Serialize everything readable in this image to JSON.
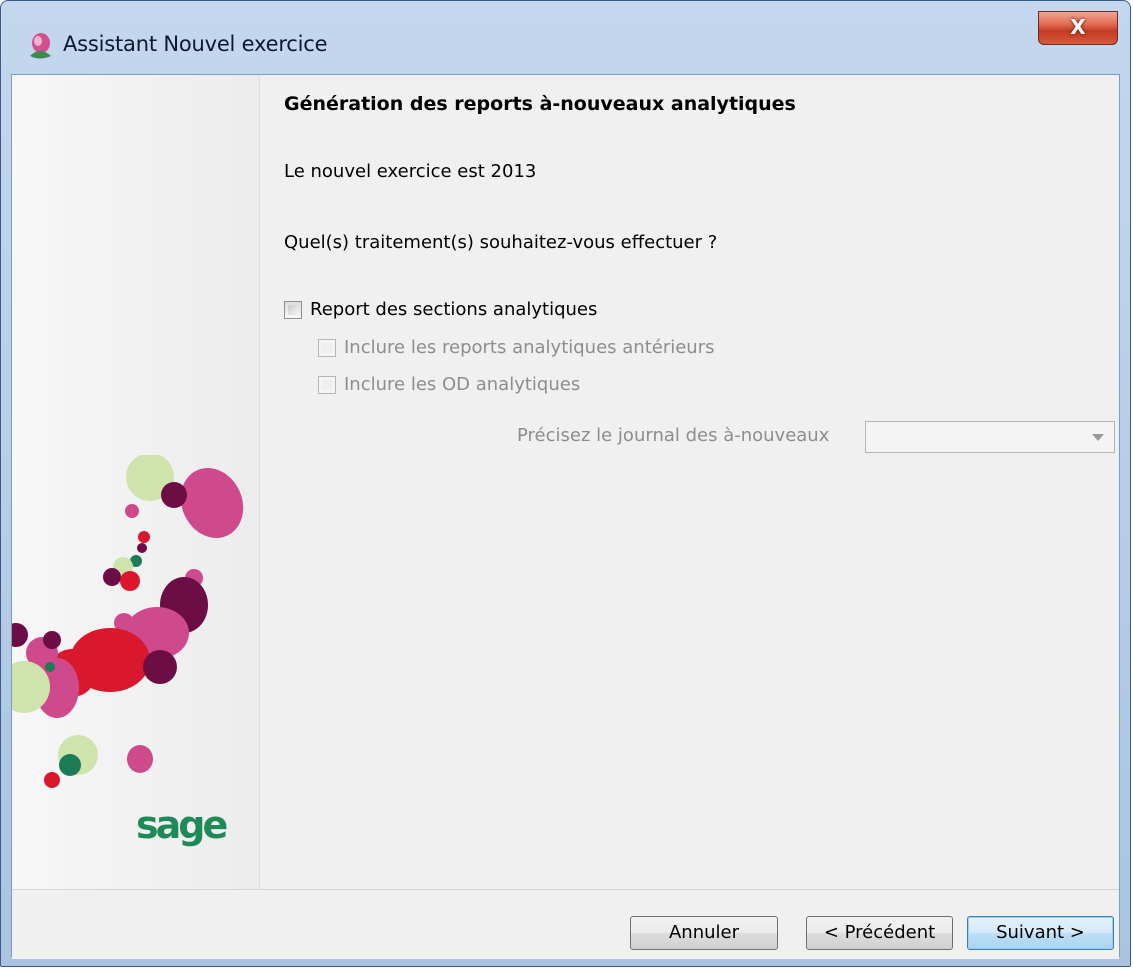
{
  "window": {
    "title": "Assistant Nouvel exercice",
    "close_label": "X"
  },
  "content": {
    "heading": "Génération des reports à-nouveaux analytiques",
    "new_year_text": "Le nouvel exercice est 2013",
    "question": "Quel(s) traitement(s) souhaitez-vous effectuer ?",
    "options": {
      "report_sections": {
        "label": "Report des sections analytiques",
        "checked": false,
        "enabled": true
      },
      "include_prior": {
        "label": "Inclure les reports analytiques antérieurs",
        "checked": false,
        "enabled": false
      },
      "include_od": {
        "label": "Inclure les OD analytiques",
        "checked": false,
        "enabled": false
      }
    },
    "journal": {
      "label": "Précisez le journal des à-nouveaux",
      "value": "",
      "enabled": false
    }
  },
  "branding": {
    "logo_text": "sage",
    "logo_color": "#1d8a57"
  },
  "footer": {
    "cancel_label": "Annuler",
    "previous_label": "< Précédent",
    "next_label": "Suivant >"
  },
  "colors": {
    "title_bar": "#b8cfe9",
    "close_button": "#c23a22",
    "dialog_bg": "#f0f0f0",
    "disabled_text": "#8d8d8d"
  }
}
